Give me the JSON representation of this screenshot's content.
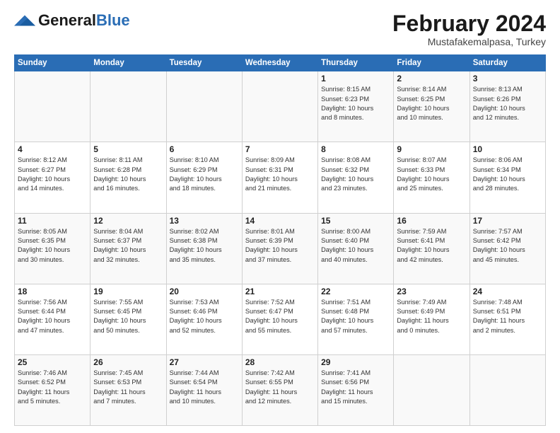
{
  "logo": {
    "general": "General",
    "blue": "Blue"
  },
  "title": "February 2024",
  "location": "Mustafakemalpasa, Turkey",
  "days_header": [
    "Sunday",
    "Monday",
    "Tuesday",
    "Wednesday",
    "Thursday",
    "Friday",
    "Saturday"
  ],
  "weeks": [
    [
      {
        "num": "",
        "info": ""
      },
      {
        "num": "",
        "info": ""
      },
      {
        "num": "",
        "info": ""
      },
      {
        "num": "",
        "info": ""
      },
      {
        "num": "1",
        "info": "Sunrise: 8:15 AM\nSunset: 6:23 PM\nDaylight: 10 hours\nand 8 minutes."
      },
      {
        "num": "2",
        "info": "Sunrise: 8:14 AM\nSunset: 6:25 PM\nDaylight: 10 hours\nand 10 minutes."
      },
      {
        "num": "3",
        "info": "Sunrise: 8:13 AM\nSunset: 6:26 PM\nDaylight: 10 hours\nand 12 minutes."
      }
    ],
    [
      {
        "num": "4",
        "info": "Sunrise: 8:12 AM\nSunset: 6:27 PM\nDaylight: 10 hours\nand 14 minutes."
      },
      {
        "num": "5",
        "info": "Sunrise: 8:11 AM\nSunset: 6:28 PM\nDaylight: 10 hours\nand 16 minutes."
      },
      {
        "num": "6",
        "info": "Sunrise: 8:10 AM\nSunset: 6:29 PM\nDaylight: 10 hours\nand 18 minutes."
      },
      {
        "num": "7",
        "info": "Sunrise: 8:09 AM\nSunset: 6:31 PM\nDaylight: 10 hours\nand 21 minutes."
      },
      {
        "num": "8",
        "info": "Sunrise: 8:08 AM\nSunset: 6:32 PM\nDaylight: 10 hours\nand 23 minutes."
      },
      {
        "num": "9",
        "info": "Sunrise: 8:07 AM\nSunset: 6:33 PM\nDaylight: 10 hours\nand 25 minutes."
      },
      {
        "num": "10",
        "info": "Sunrise: 8:06 AM\nSunset: 6:34 PM\nDaylight: 10 hours\nand 28 minutes."
      }
    ],
    [
      {
        "num": "11",
        "info": "Sunrise: 8:05 AM\nSunset: 6:35 PM\nDaylight: 10 hours\nand 30 minutes."
      },
      {
        "num": "12",
        "info": "Sunrise: 8:04 AM\nSunset: 6:37 PM\nDaylight: 10 hours\nand 32 minutes."
      },
      {
        "num": "13",
        "info": "Sunrise: 8:02 AM\nSunset: 6:38 PM\nDaylight: 10 hours\nand 35 minutes."
      },
      {
        "num": "14",
        "info": "Sunrise: 8:01 AM\nSunset: 6:39 PM\nDaylight: 10 hours\nand 37 minutes."
      },
      {
        "num": "15",
        "info": "Sunrise: 8:00 AM\nSunset: 6:40 PM\nDaylight: 10 hours\nand 40 minutes."
      },
      {
        "num": "16",
        "info": "Sunrise: 7:59 AM\nSunset: 6:41 PM\nDaylight: 10 hours\nand 42 minutes."
      },
      {
        "num": "17",
        "info": "Sunrise: 7:57 AM\nSunset: 6:42 PM\nDaylight: 10 hours\nand 45 minutes."
      }
    ],
    [
      {
        "num": "18",
        "info": "Sunrise: 7:56 AM\nSunset: 6:44 PM\nDaylight: 10 hours\nand 47 minutes."
      },
      {
        "num": "19",
        "info": "Sunrise: 7:55 AM\nSunset: 6:45 PM\nDaylight: 10 hours\nand 50 minutes."
      },
      {
        "num": "20",
        "info": "Sunrise: 7:53 AM\nSunset: 6:46 PM\nDaylight: 10 hours\nand 52 minutes."
      },
      {
        "num": "21",
        "info": "Sunrise: 7:52 AM\nSunset: 6:47 PM\nDaylight: 10 hours\nand 55 minutes."
      },
      {
        "num": "22",
        "info": "Sunrise: 7:51 AM\nSunset: 6:48 PM\nDaylight: 10 hours\nand 57 minutes."
      },
      {
        "num": "23",
        "info": "Sunrise: 7:49 AM\nSunset: 6:49 PM\nDaylight: 11 hours\nand 0 minutes."
      },
      {
        "num": "24",
        "info": "Sunrise: 7:48 AM\nSunset: 6:51 PM\nDaylight: 11 hours\nand 2 minutes."
      }
    ],
    [
      {
        "num": "25",
        "info": "Sunrise: 7:46 AM\nSunset: 6:52 PM\nDaylight: 11 hours\nand 5 minutes."
      },
      {
        "num": "26",
        "info": "Sunrise: 7:45 AM\nSunset: 6:53 PM\nDaylight: 11 hours\nand 7 minutes."
      },
      {
        "num": "27",
        "info": "Sunrise: 7:44 AM\nSunset: 6:54 PM\nDaylight: 11 hours\nand 10 minutes."
      },
      {
        "num": "28",
        "info": "Sunrise: 7:42 AM\nSunset: 6:55 PM\nDaylight: 11 hours\nand 12 minutes."
      },
      {
        "num": "29",
        "info": "Sunrise: 7:41 AM\nSunset: 6:56 PM\nDaylight: 11 hours\nand 15 minutes."
      },
      {
        "num": "",
        "info": ""
      },
      {
        "num": "",
        "info": ""
      }
    ]
  ]
}
